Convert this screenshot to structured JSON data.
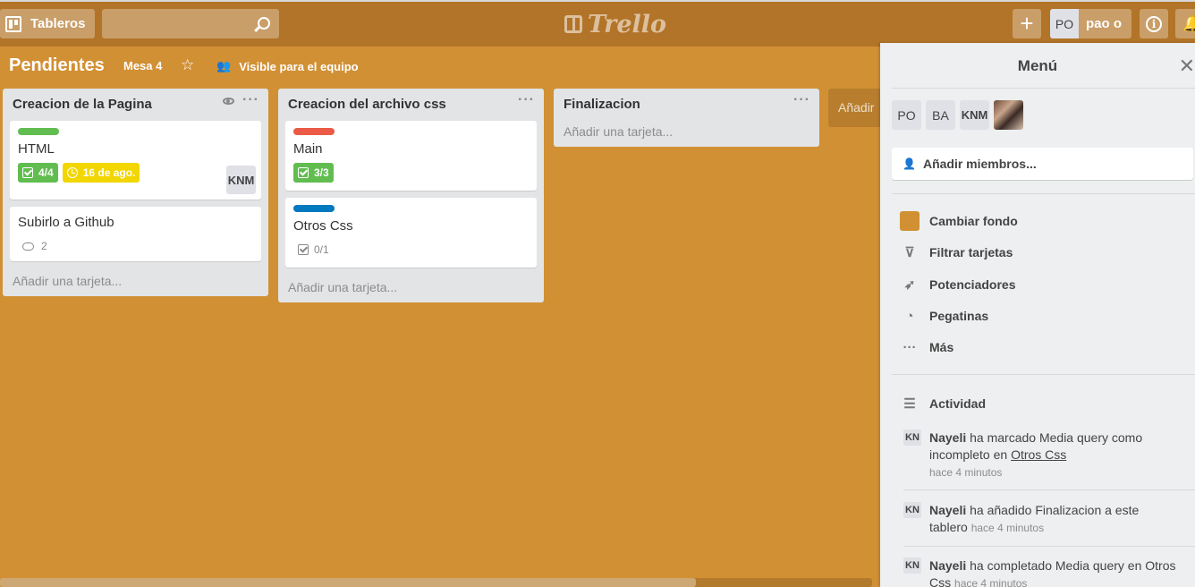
{
  "header": {
    "boards_label": "Tableros",
    "search_placeholder": "",
    "logo_text": "Trello",
    "add_label": "+",
    "user_initials": "PO",
    "user_name": "pao o",
    "info_label": "i"
  },
  "board": {
    "title": "Pendientes",
    "team": "Mesa 4",
    "visibility": "Visible para el equipo"
  },
  "lists": [
    {
      "title": "Creacion de la Pagina",
      "add_card": "Añadir una tarjeta...",
      "cards": [
        {
          "label_color": "#61bd4f",
          "title": "HTML",
          "checklist": "4/4",
          "due": "16 de ago.",
          "member": "KNM"
        },
        {
          "title": "Subirlo a Github",
          "comments": "2"
        }
      ]
    },
    {
      "title": "Creacion del archivo css",
      "add_card": "Añadir una tarjeta...",
      "cards": [
        {
          "label_color": "#eb5a46",
          "title": "Main",
          "checklist": "3/3"
        },
        {
          "label_color": "#0079bf",
          "title": "Otros Css",
          "checklist": "0/1"
        }
      ]
    },
    {
      "title": "Finalizacion",
      "add_card": "Añadir una tarjeta..."
    }
  ],
  "add_list": "Añadir",
  "menu": {
    "title": "Menú",
    "members": [
      "PO",
      "BA",
      "KNM"
    ],
    "add_members": "Añadir miembros...",
    "items": [
      {
        "label": "Cambiar fondo",
        "icon": "background-swatch"
      },
      {
        "label": "Filtrar tarjetas",
        "icon": "filter-icon"
      },
      {
        "label": "Potenciadores",
        "icon": "rocket-icon"
      },
      {
        "label": "Pegatinas",
        "icon": "sticker-icon"
      },
      {
        "label": "Más",
        "icon": "more-icon"
      }
    ],
    "activity_title": "Actividad",
    "activity": [
      {
        "avatar": "KN",
        "user": "Nayeli",
        "text": "ha marcado Media query como incompleto en",
        "link": "Otros Css",
        "time": "hace 4 minutos"
      },
      {
        "avatar": "KN",
        "user": "Nayeli",
        "text": "ha añadido Finalizacion a este tablero",
        "time": "hace 4 minutos"
      },
      {
        "avatar": "KN",
        "user": "Nayeli",
        "text": "ha completado Media query en Otros Css",
        "time": "hace 4 minutos"
      }
    ]
  },
  "colors": {
    "board_bg": "#d29034",
    "header_bg": "#b27428",
    "green": "#61bd4f",
    "yellow": "#f2d600",
    "red": "#eb5a46",
    "blue": "#0079bf"
  }
}
